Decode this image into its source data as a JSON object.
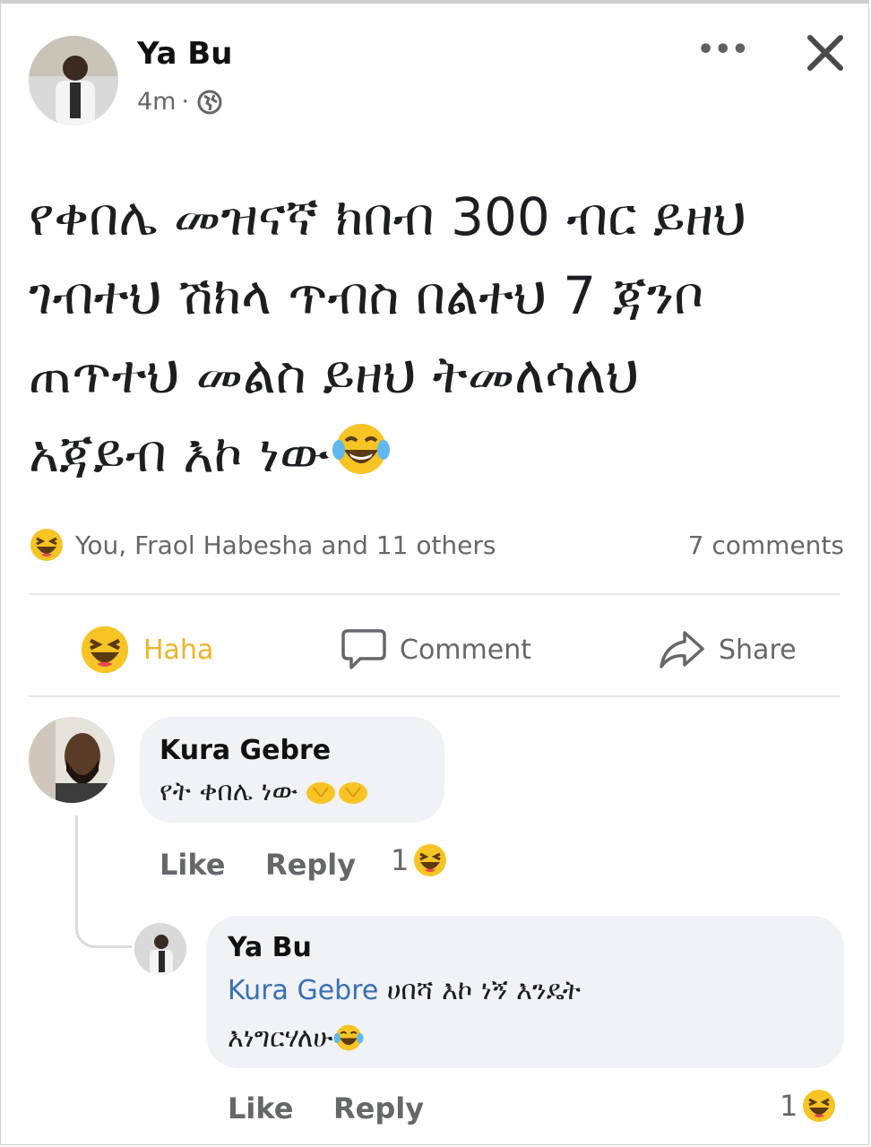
{
  "post": {
    "author": "Ya Bu",
    "time": "4m",
    "separator": "·",
    "more_label": "•••",
    "text_lines": [
      "የቀበሌ መዝናኛ ክበብ 300 ብር ይዘህ",
      "ገብተህ ሽክላ ጥብስ በልተህ 7 ጃንቦ",
      "ጠጥተህ መልስ ይዘህ ትመለሳለህ",
      "አጃይብ እኮ ነው"
    ],
    "reaction_summary": "You, Fraol Habesha and 11 others",
    "comments_count": "7 comments"
  },
  "actions": {
    "haha": "Haha",
    "comment": "Comment",
    "share": "Share"
  },
  "comments": [
    {
      "author": "Kura Gebre",
      "text": "የት ቀበሌ ነው",
      "like": "Like",
      "reply": "Reply",
      "reaction_count": "1"
    },
    {
      "author": "Ya Bu",
      "mention": "Kura Gebre",
      "text_line1": " ሀበሻ እኮ ነኝ እንዴት",
      "text_line2": "እነግርሃለሁ",
      "like": "Like",
      "reply": "Reply",
      "reaction_count": "1"
    }
  ],
  "colors": {
    "haha_yellow": "#f7c425",
    "meta_gray": "#65676b",
    "mention_blue": "#3a6fb6",
    "bubble_bg": "#f0f2f5"
  }
}
